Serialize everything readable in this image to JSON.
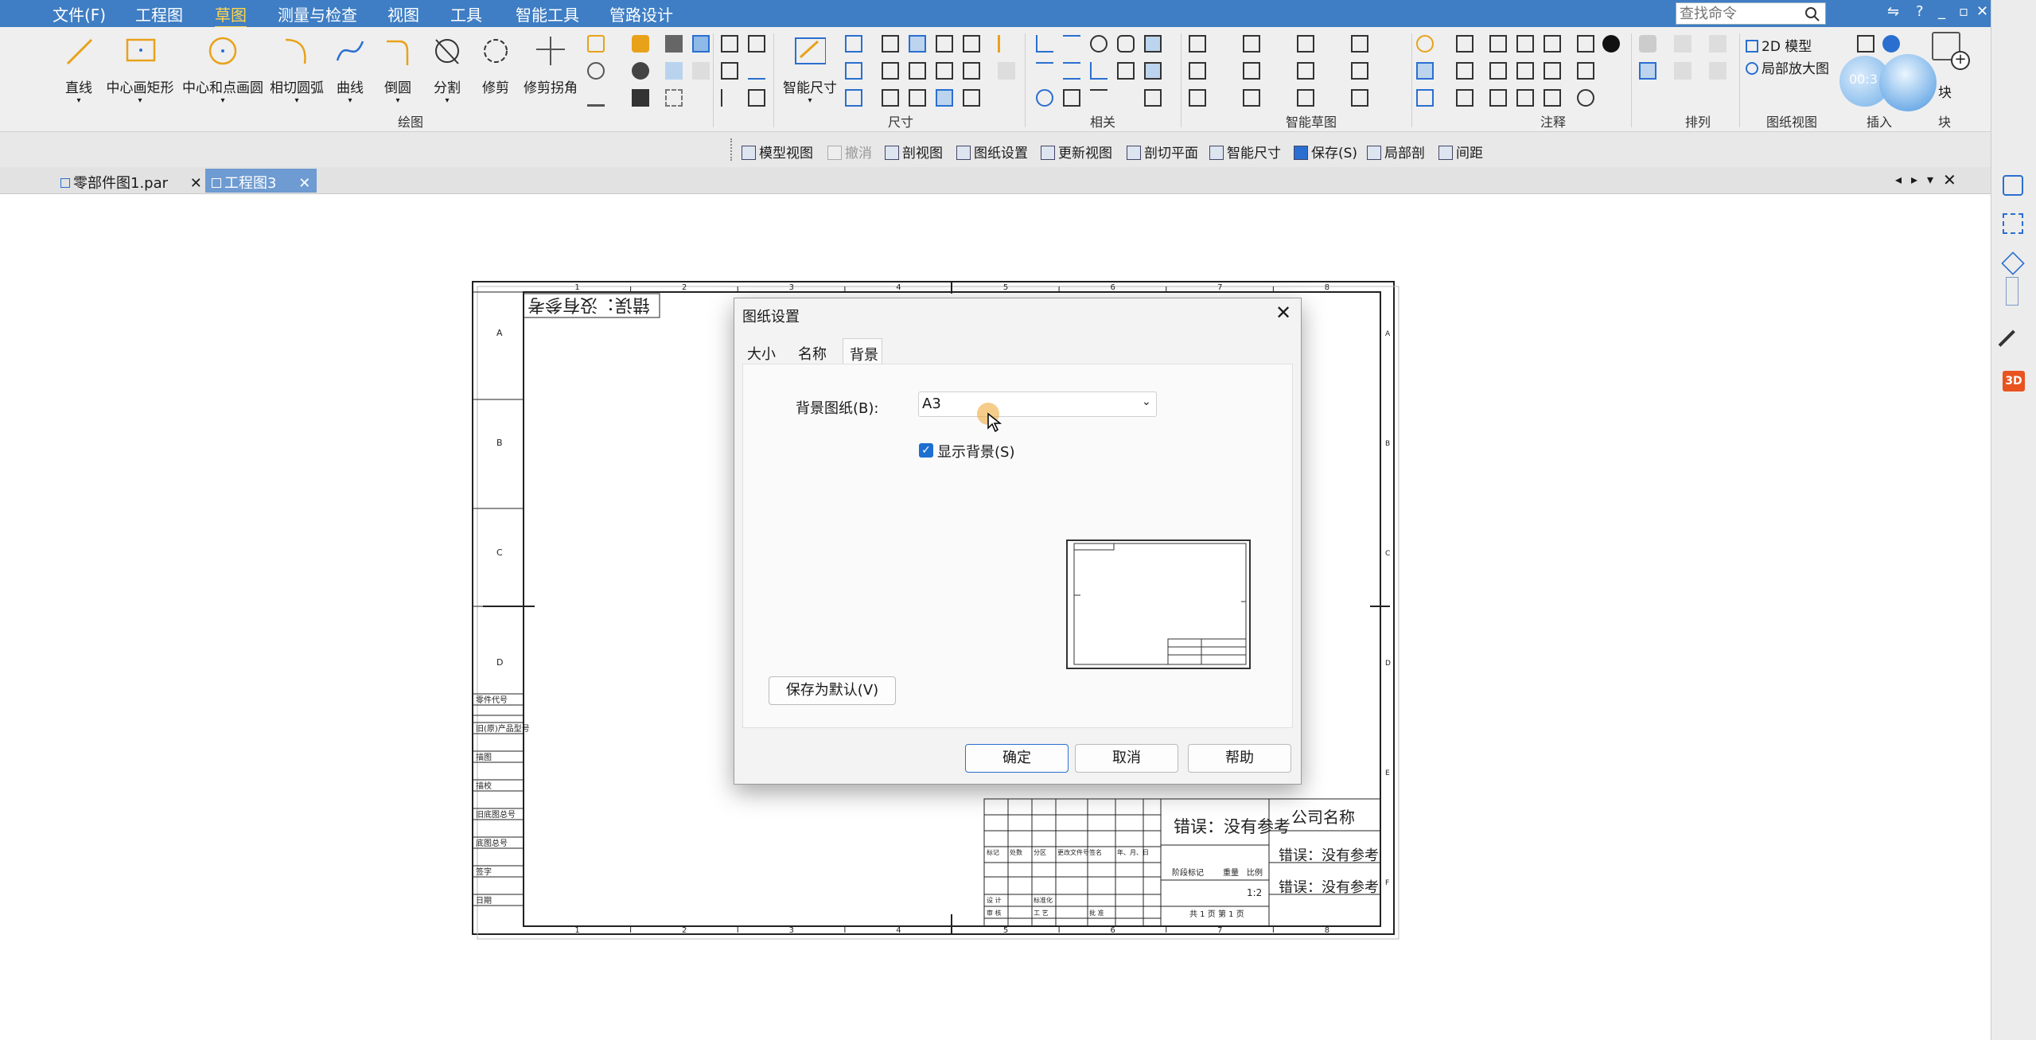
{
  "menubar": {
    "items": [
      "文件(F)",
      "工程图",
      "草图",
      "测量与检查",
      "视图",
      "工具",
      "智能工具",
      "管路设计"
    ],
    "active_index": 2,
    "search_placeholder": "查找命令",
    "win_controls": [
      "?",
      "_",
      "▫",
      "✕"
    ]
  },
  "ribbon": {
    "draw_tools": [
      "直线",
      "中心画矩形",
      "中心和点画圆",
      "相切圆弧",
      "曲线",
      "倒圆",
      "分割",
      "修剪",
      "修剪拐角"
    ],
    "smart_dim_label": "智能尺寸",
    "group_labels": {
      "draw": "绘图",
      "dim": "尺寸",
      "rel": "相关",
      "smart": "智能草图",
      "annot": "注释",
      "arrange": "排列",
      "view": "图纸视图",
      "insert": "插入",
      "block": "块"
    },
    "view_model_2d": "2D 模型",
    "view_local_zoom": "局部放大图",
    "timer": "00:3",
    "block_label": "块"
  },
  "toolbar2": {
    "items": [
      "模型视图",
      "撤消",
      "剖视图",
      "图纸设置",
      "更新视图",
      "剖切平面",
      "智能尺寸",
      "保存(S)",
      "局部剖",
      "间距"
    ]
  },
  "doc_tabs": [
    {
      "label": "零部件图1.par",
      "active": false
    },
    {
      "label": "工程图3",
      "active": true
    }
  ],
  "drawing": {
    "col_numbers": [
      "1",
      "2",
      "3",
      "4",
      "5",
      "6",
      "7",
      "8"
    ],
    "row_letters": [
      "A",
      "B",
      "C",
      "D"
    ],
    "right_letters": [
      "A",
      "B",
      "C",
      "D",
      "E",
      "F"
    ],
    "top_error": "错误：没有参考",
    "side_labels": [
      "零件代号",
      "旧(原)产品型号",
      "描图",
      "描校",
      "旧底图总号",
      "底图总号",
      "签字",
      "日期"
    ],
    "title_block": {
      "error_main": "错误：没有参考",
      "company": "公司名称",
      "error2": "错误：没有参考",
      "error3": "错误：没有参考",
      "scale": "1:2",
      "sheet_of": "共 1 页",
      "sheet_no": "第 1 页",
      "stage": "阶段标记",
      "weight": "重量",
      "scale_label": "比例",
      "cells": [
        "标记",
        "处数",
        "分区",
        "更改文件号",
        "签名",
        "年、月、日",
        "设 计",
        "标准化",
        "审 核",
        "工 艺",
        "批 准"
      ]
    }
  },
  "dialog": {
    "title": "图纸设置",
    "tabs": [
      "大小",
      "名称",
      "背景"
    ],
    "active_tab": 2,
    "bg_label": "背景图纸(B):",
    "bg_value": "A3",
    "show_bg_label": "显示背景(S)",
    "show_bg_checked": true,
    "save_default": "保存为默认(V)",
    "ok": "确定",
    "cancel": "取消",
    "help": "帮助"
  },
  "colors": {
    "menubar": "#3f7ec4",
    "active_menu": "#ffd54a",
    "ribbon": "#efefef",
    "active_tab": "#6e9bd1"
  }
}
